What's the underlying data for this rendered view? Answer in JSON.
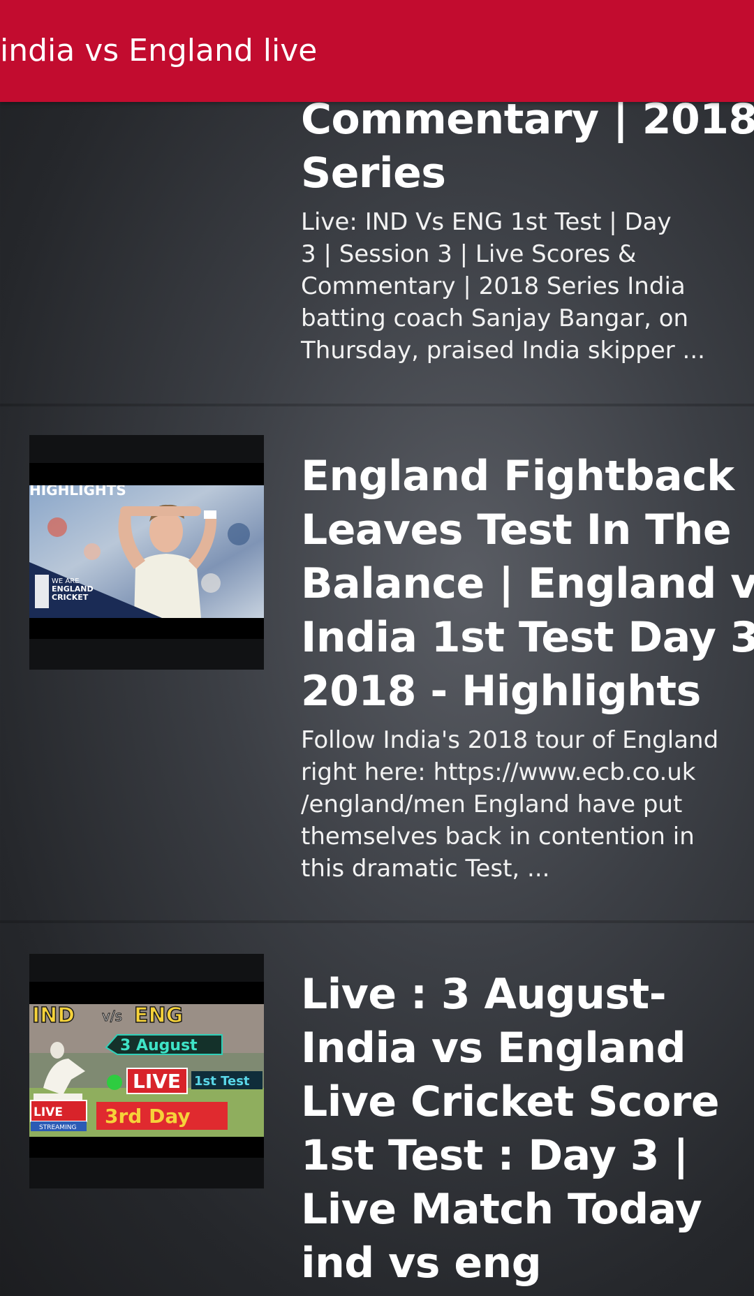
{
  "appbar": {
    "title": "india vs England live"
  },
  "cards": [
    {
      "title_lines": [
        "Commentary | 2018",
        "Series"
      ],
      "description_lines": [
        "Live: IND Vs ENG 1st Test | Day",
        "3 | Session 3 | Live Scores &",
        "Commentary | 2018 Series India",
        "batting coach Sanjay Bangar, on",
        "Thursday, praised India skipper ..."
      ]
    },
    {
      "title_lines": [
        "England Fightback",
        "Leaves Test In The",
        "Balance | England v",
        "India 1st Test Day 3",
        "2018 - Highlights"
      ],
      "description_lines": [
        "Follow India's 2018 tour of England",
        "right here: https://www.ecb.co.uk",
        "/england/men England have put",
        "themselves back in contention in",
        "this dramatic Test, ..."
      ],
      "thumbnail": {
        "banner": "HIGHLIGHTS",
        "logo_lines": [
          "WE ARE",
          "ENGLAND",
          "CRICKET"
        ]
      }
    },
    {
      "title_lines": [
        "Live : 3 August-",
        "India vs England",
        "Live Cricket Score",
        "1st Test : Day 3 |",
        "Live Match Today",
        "ind vs eng"
      ],
      "thumbnail": {
        "team_a": "IND",
        "vs": "v/s",
        "team_b": "ENG",
        "date": "3 August",
        "live": "LIVE",
        "test_label": "1st Test",
        "day_label": "3rd Day",
        "live_badge": "LIVE",
        "streaming": "STREAMING"
      }
    }
  ],
  "colors": {
    "appbar": "#c20c2f",
    "background": "#3c3f45",
    "text": "#ffffff"
  }
}
